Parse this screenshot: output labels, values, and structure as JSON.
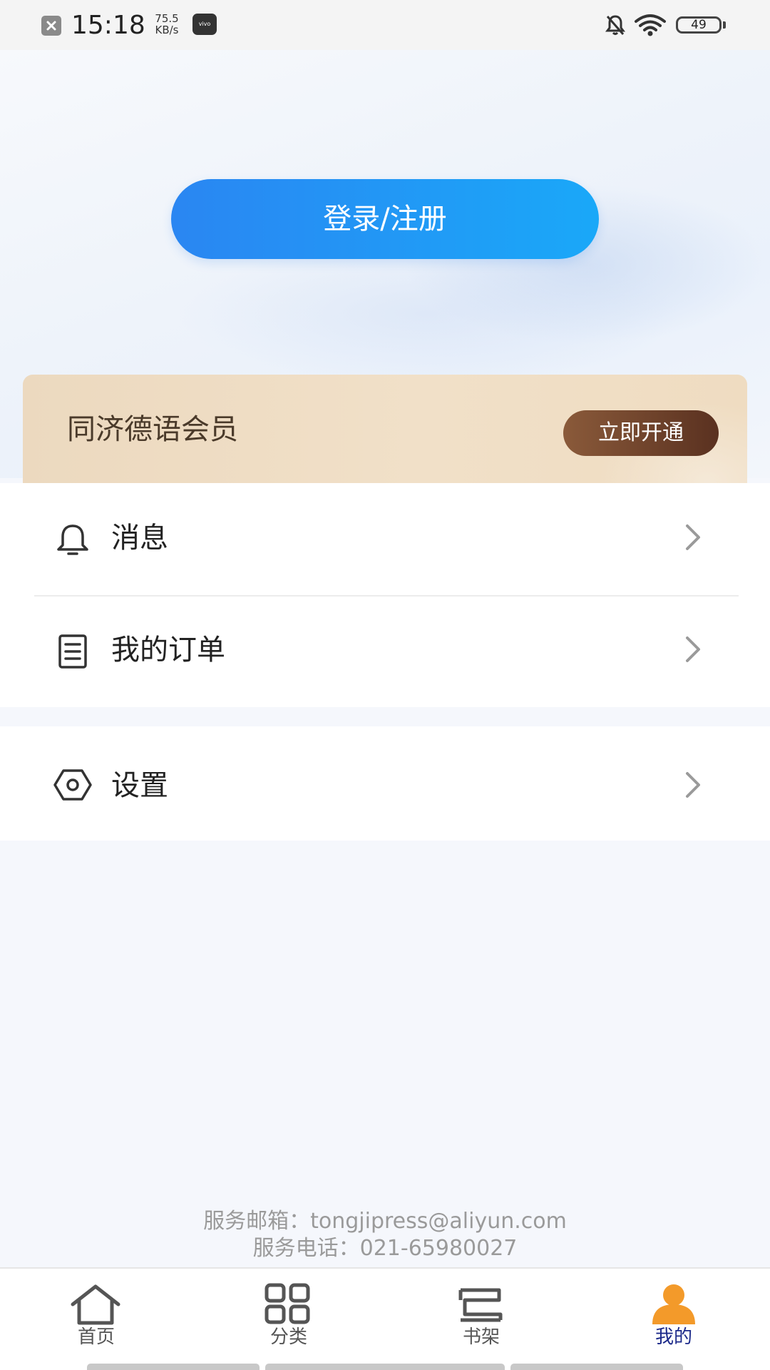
{
  "status_bar": {
    "time": "15:18",
    "speed_value": "75.5",
    "speed_unit": "KB/s",
    "vivo_badge": "vivo",
    "battery": "49",
    "icons": [
      "close-notification-icon",
      "bell-muted-icon",
      "wifi-icon",
      "battery-icon"
    ]
  },
  "header": {
    "login_label": "登录/注册"
  },
  "member_card": {
    "title": "同济德语会员",
    "button_label": "立即开通"
  },
  "menu": {
    "items": [
      {
        "label": "消息",
        "icon": "bell-icon"
      },
      {
        "label": "我的订单",
        "icon": "receipt-icon"
      },
      {
        "label": "设置",
        "icon": "settings-icon"
      }
    ]
  },
  "footer": {
    "email": "服务邮箱：tongjipress@aliyun.com",
    "phone": "服务电话：021-65980027"
  },
  "bottom_nav": {
    "items": [
      {
        "label": "首页",
        "icon": "home-icon",
        "active": false
      },
      {
        "label": "分类",
        "icon": "category-grid-icon",
        "active": false
      },
      {
        "label": "书架",
        "icon": "bookshelf-icon",
        "active": false
      },
      {
        "label": "我的",
        "icon": "profile-icon",
        "active": true
      }
    ]
  },
  "colors": {
    "accent_blue": "#2a86f2",
    "active_nav_icon": "#f39a2a",
    "active_nav_label": "#1c2a8a",
    "member_button": "#5a3120"
  }
}
